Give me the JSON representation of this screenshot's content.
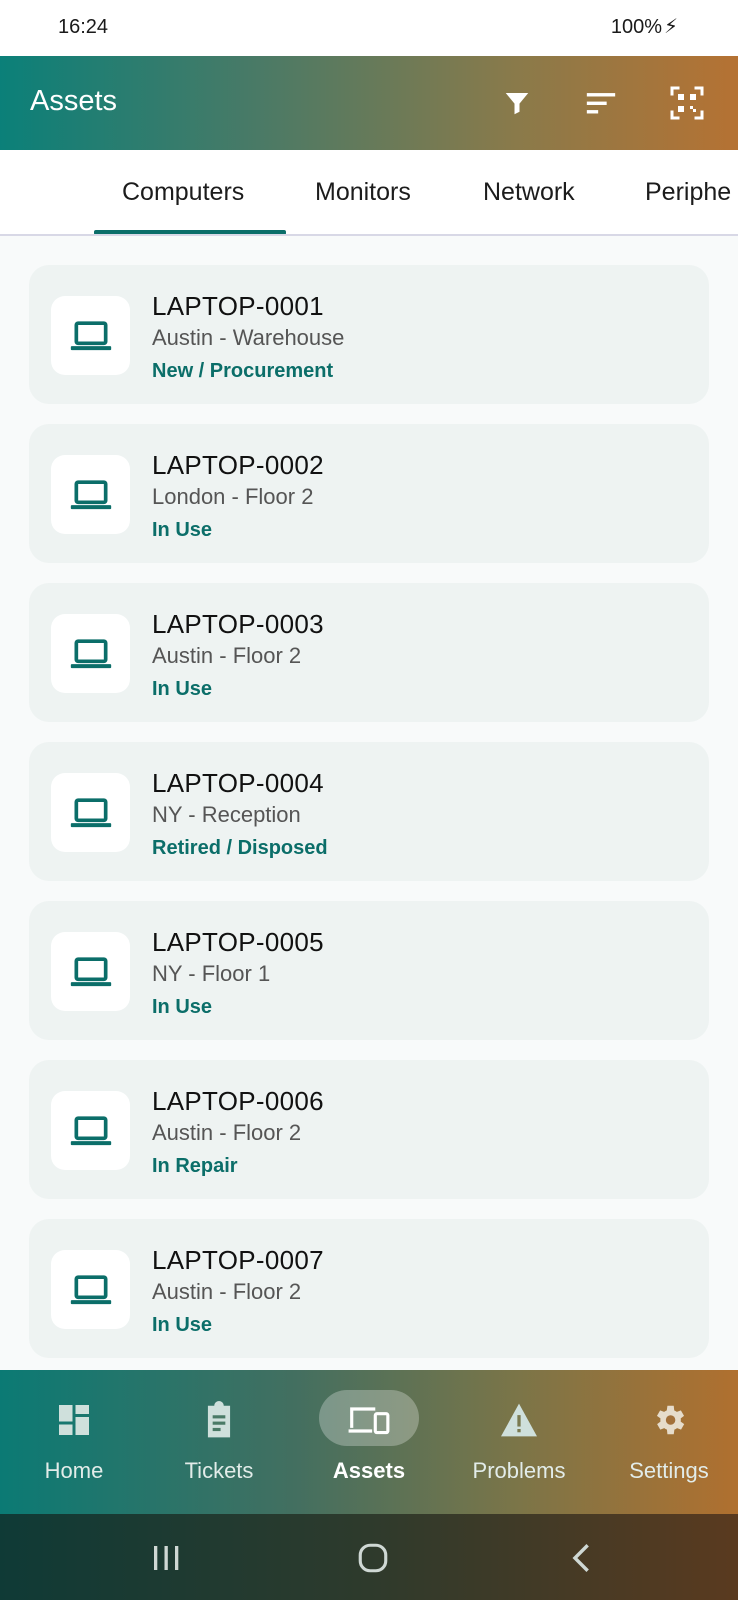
{
  "status_bar": {
    "time": "16:24",
    "right": "100%"
  },
  "app_bar": {
    "title": "Assets",
    "icons": [
      "filter-icon",
      "sort-icon",
      "qr-code-icon"
    ]
  },
  "tabs": [
    {
      "label": "Computers",
      "selected": true
    },
    {
      "label": "Monitors",
      "selected": false
    },
    {
      "label": "Network",
      "selected": false
    },
    {
      "label": "Periphe",
      "selected": false
    }
  ],
  "assets": [
    {
      "name": "LAPTOP-0001",
      "location": "Austin - Warehouse",
      "status": "New / Procurement"
    },
    {
      "name": "LAPTOP-0002",
      "location": "London - Floor 2",
      "status": "In Use"
    },
    {
      "name": "LAPTOP-0003",
      "location": "Austin - Floor 2",
      "status": "In Use"
    },
    {
      "name": "LAPTOP-0004",
      "location": "NY - Reception",
      "status": "Retired / Disposed"
    },
    {
      "name": "LAPTOP-0005",
      "location": "NY - Floor 1",
      "status": "In Use"
    },
    {
      "name": "LAPTOP-0006",
      "location": "Austin - Floor 2",
      "status": "In Repair"
    },
    {
      "name": "LAPTOP-0007",
      "location": "Austin - Floor 2",
      "status": "In Use"
    }
  ],
  "bottom_nav": [
    {
      "label": "Home",
      "icon": "dashboard-icon",
      "active": false
    },
    {
      "label": "Tickets",
      "icon": "clipboard-icon",
      "active": false
    },
    {
      "label": "Assets",
      "icon": "devices-icon",
      "active": true
    },
    {
      "label": "Problems",
      "icon": "warning-icon",
      "active": false
    },
    {
      "label": "Settings",
      "icon": "gear-icon",
      "active": false
    }
  ],
  "colors": {
    "accent": "#0b6e69",
    "card_bg": "#eef3f2",
    "app_bar_start": "#0b8079",
    "app_bar_end": "#b57233"
  }
}
